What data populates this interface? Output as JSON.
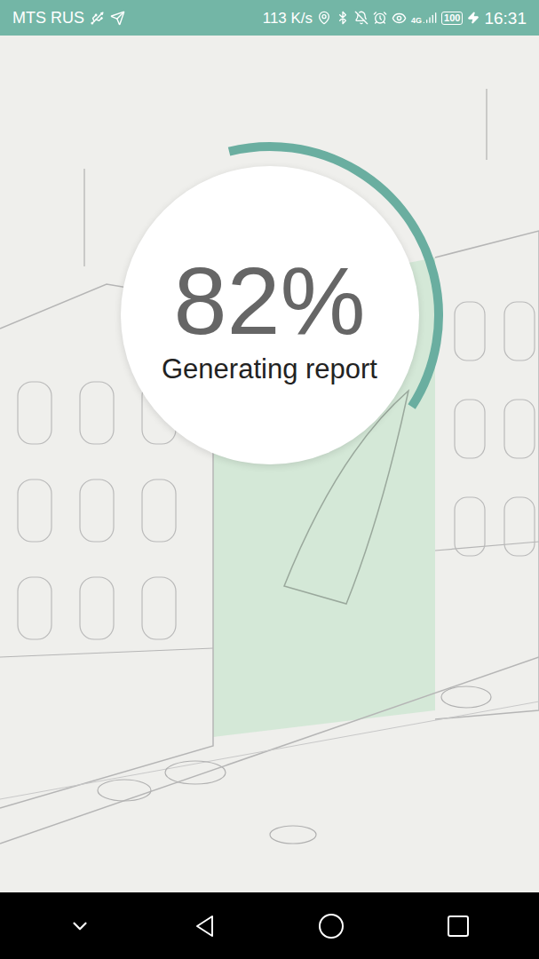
{
  "status_bar": {
    "carrier": "MTS RUS",
    "network_speed": "113 K/s",
    "network_type": "4G",
    "battery": "100",
    "time": "16:31",
    "charging": true
  },
  "progress": {
    "percent": "82%",
    "label": "Generating report",
    "level": 0.38
  }
}
